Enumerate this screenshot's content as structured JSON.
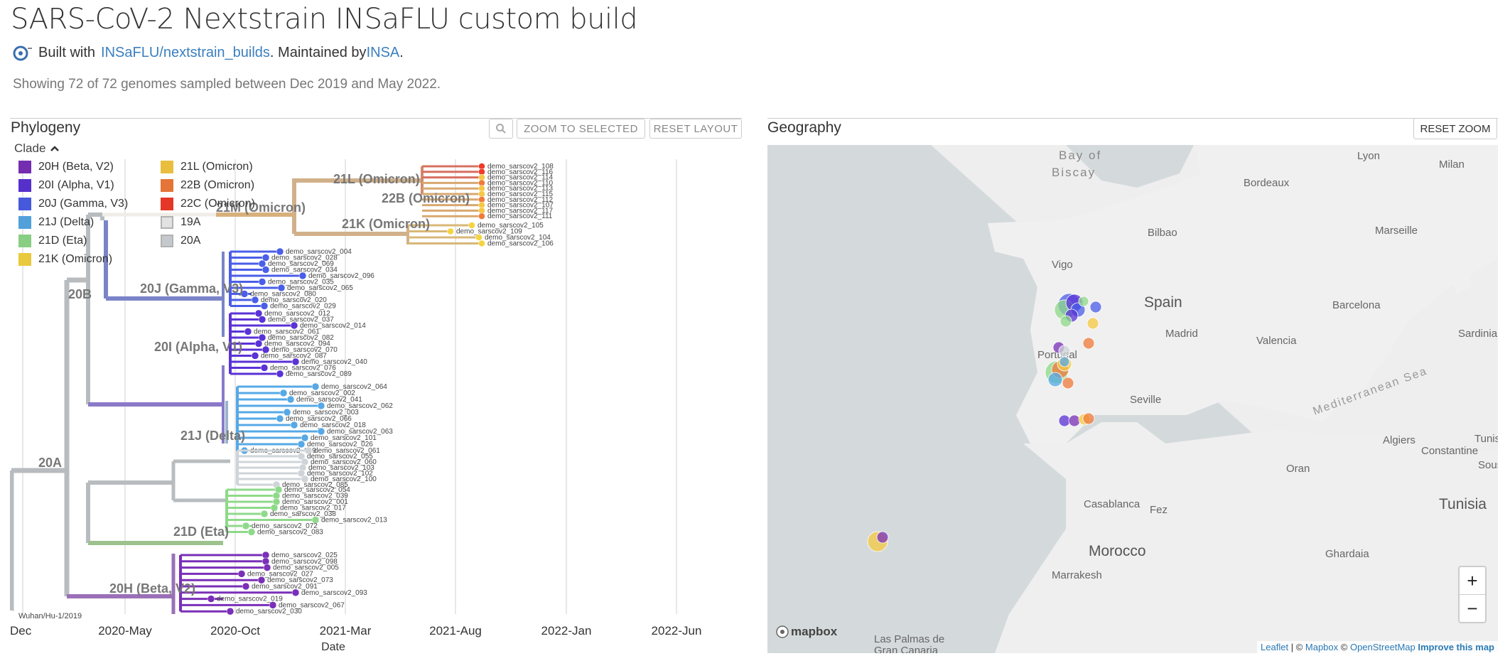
{
  "header": {
    "title": "SARS-CoV-2 Nextstrain INSaFLU custom build",
    "built_with_prefix": "Built with ",
    "built_with_link": "INSaFLU/nextstrain_builds",
    "maintained_prefix": ". Maintained by ",
    "maintained_link": "INSA",
    "maintained_suffix": ".",
    "summary": "Showing 72 of 72 genomes sampled between Dec 2019 and May 2022."
  },
  "phylogeny": {
    "title": "Phylogeny",
    "zoom_selected_label": "ZOOM TO SELECTED",
    "reset_layout_label": "RESET LAYOUT",
    "search_icon": "magnifier-icon",
    "legend_toggle": "Clade",
    "legend": [
      {
        "label": "20H (Beta, V2)",
        "color": "#7a2fb8"
      },
      {
        "label": "20I (Alpha, V1)",
        "color": "#5a32d6"
      },
      {
        "label": "20J (Gamma, V3)",
        "color": "#4a5ee8"
      },
      {
        "label": "21J (Delta)",
        "color": "#56a9e6"
      },
      {
        "label": "21D (Eta)",
        "color": "#8fd98a"
      },
      {
        "label": "21K (Omicron)",
        "color": "#f5d440"
      },
      {
        "label": "21L (Omicron)",
        "color": "#f5c842"
      },
      {
        "label": "22B (Omicron)",
        "color": "#f07a3a"
      },
      {
        "label": "22C (Omicron)",
        "color": "#f03a2a"
      },
      {
        "label": "19A",
        "color": "#eeeeee"
      },
      {
        "label": "20A",
        "color": "#cfd4d8"
      }
    ],
    "clade_labels": [
      {
        "label": "21M (Omicron)"
      },
      {
        "label": "21L (Omicron)"
      },
      {
        "label": "22B (Omicron)"
      },
      {
        "label": "21K (Omicron)"
      },
      {
        "label": "20J (Gamma, V3)"
      },
      {
        "label": "20B"
      },
      {
        "label": "20I (Alpha, V1)"
      },
      {
        "label": "21J (Delta)"
      },
      {
        "label": "20A"
      },
      {
        "label": "21D (Eta)"
      },
      {
        "label": "20H (Beta, V2)"
      }
    ],
    "root_tip": "Wuhan/Hu-1/2019",
    "axis_ticks": [
      "Dec",
      "2020-May",
      "2020-Oct",
      "2021-Mar",
      "2021-Aug",
      "2022-Jan",
      "2022-Jun"
    ],
    "axis_title": "Date",
    "groups": [
      {
        "name": "omicron",
        "color": "#f5c842",
        "tips": [
          "demo_sarscov2_108",
          "demo_sarscov2_116",
          "demo_sarscov2_114",
          "demo_sarscov2_110",
          "demo_sarscov2_113",
          "demo_sarscov2_115",
          "demo_sarscov2_112",
          "demo_sarscov2_107",
          "demo_sarscov2_117",
          "demo_sarscov2_111"
        ]
      },
      {
        "name": "omicron21k",
        "color": "#f5d440",
        "tips": [
          "demo_sarscov2_105",
          "demo_sarscov2_109",
          "demo_sarscov2_104",
          "demo_sarscov2_106"
        ]
      },
      {
        "name": "gamma",
        "color": "#4a5ee8",
        "tips": [
          "demo_sarscov2_004",
          "demo_sarscov2_028",
          "demo_sarscov2_069",
          "demo_sarscov2_034",
          "demo_sarscov2_096",
          "demo_sarscov2_035",
          "demo_sarscov2_065",
          "demo_sarscov2_080",
          "demo_sarscov2_020",
          "demo_sarscov2_029"
        ]
      },
      {
        "name": "alpha",
        "color": "#5a32d6",
        "tips": [
          "demo_sarscov2_012",
          "demo_sarscov2_037",
          "demo_sarscov2_014",
          "demo_sarscov2_061",
          "demo_sarscov2_082",
          "demo_sarscov2_094",
          "demo_sarscov2_070",
          "demo_sarscov2_087",
          "demo_sarscov2_040",
          "demo_sarscov2_076",
          "demo_sarscov2_089"
        ]
      },
      {
        "name": "delta",
        "color": "#56a9e6",
        "tips": [
          "demo_sarscov2_064",
          "demo_sarscov2_002",
          "demo_sarscov2_041",
          "demo_sarscov2_062",
          "demo_sarscov2_003",
          "demo_sarscov2_066",
          "demo_sarscov2_018",
          "demo_sarscov2_063",
          "demo_sarscov2_101",
          "demo_sarscov2_026",
          "demo_sarscov2_049"
        ]
      },
      {
        "name": "clade20a",
        "color": "#cfd4d8",
        "tips": [
          "demo_sarscov2_061",
          "demo_sarscov2_055",
          "demo_sarscov2_060",
          "demo_sarscov2_103",
          "demo_sarscov2_102",
          "demo_sarscov2_100",
          "demo_sarscov2_085"
        ]
      },
      {
        "name": "eta",
        "color": "#8fd98a",
        "tips": [
          "demo_sarscov2_054",
          "demo_sarscov2_039",
          "demo_sarscov2_001",
          "demo_sarscov2_017",
          "demo_sarscov2_038",
          "demo_sarscov2_013",
          "demo_sarscov2_072",
          "demo_sarscov2_083"
        ]
      },
      {
        "name": "beta",
        "color": "#7a2fb8",
        "tips": [
          "demo_sarscov2_025",
          "demo_sarscov2_098",
          "demo_sarscov2_005",
          "demo_sarscov2_027",
          "demo_sarscov2_073",
          "demo_sarscov2_091",
          "demo_sarscov2_093",
          "demo_sarscov2_019",
          "demo_sarscov2_067",
          "demo_sarscov2_030"
        ]
      }
    ]
  },
  "geography": {
    "title": "Geography",
    "reset_zoom_label": "RESET ZOOM",
    "zoom_in": "+",
    "zoom_out": "−",
    "places": [
      "Bay of Biscay",
      "Lyon",
      "Milan",
      "Bordeaux",
      "Bilbao",
      "Marseille",
      "Vigo",
      "Spain",
      "Barcelona",
      "Madrid",
      "Valencia",
      "Sardinia",
      "Portugal",
      "Seville",
      "Mediterranean Sea",
      "Algiers",
      "Tunis",
      "Oran",
      "Constantine",
      "Sous",
      "Casablanca",
      "Fez",
      "Tunisia",
      "Morocco",
      "Ghardaia",
      "Marrakesh",
      "Las Palmas de Gran Canaria"
    ],
    "mapbox_logo": "mapbox",
    "attribution": {
      "leaflet": "Leaflet",
      "sep1": " | © ",
      "mapbox": "Mapbox",
      "sep2": " © ",
      "osm": "OpenStreetMap",
      "improve": "Improve this map"
    }
  }
}
